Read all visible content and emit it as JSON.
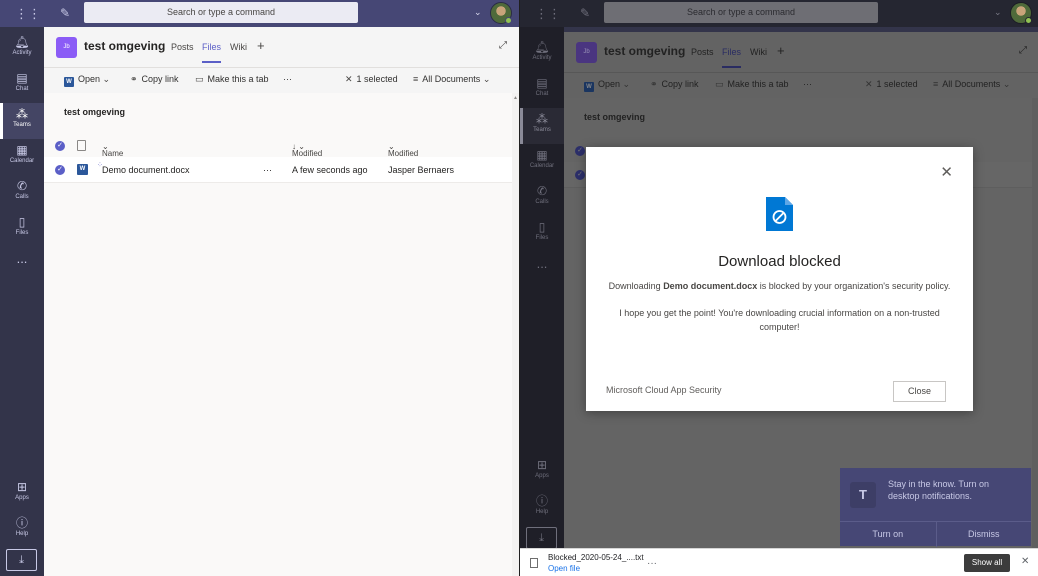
{
  "search": {
    "placeholder": "Search or type a command"
  },
  "rail": {
    "activity": "Activity",
    "chat": "Chat",
    "teams": "Teams",
    "calendar": "Calendar",
    "calls": "Calls",
    "files": "Files",
    "more": "...",
    "apps": "Apps",
    "help": "Help"
  },
  "channel": {
    "badge": "Jb",
    "team_name": "test omgeving",
    "tabs": [
      "Posts",
      "Files",
      "Wiki"
    ],
    "active_tab": "Files"
  },
  "commands": {
    "open": "Open",
    "copy_link": "Copy link",
    "make_tab": "Make this a tab",
    "more": "···",
    "selected": "1 selected",
    "view": "All Documents"
  },
  "library": {
    "title": "test omgeving",
    "columns": {
      "name": "Name",
      "modified": "Modified",
      "modified_by": "Modified By"
    },
    "rows": [
      {
        "name": "Demo document.docx",
        "modified": "A few seconds ago",
        "modified_by": "Jasper Bernaers"
      }
    ]
  },
  "modal": {
    "title": "Download blocked",
    "msg_prefix": "Downloading ",
    "msg_file": "Demo document.docx",
    "msg_suffix": " is blocked by your organization's security policy.",
    "custom_line1": "I hope you get the point! You're downloading crucial information on a non-trusted",
    "custom_line2": "computer!",
    "footer": "Microsoft Cloud App Security",
    "close_label": "Close"
  },
  "toast": {
    "text": "Stay in the know. Turn on desktop notifications.",
    "turn_on": "Turn on",
    "dismiss": "Dismiss"
  },
  "download_bar": {
    "file_name": "Blocked_2020-05-24_....txt",
    "open_file": "Open file",
    "show_all": "Show all"
  },
  "colors": {
    "teams_purple": "#464775",
    "accent": "#5b5fc7",
    "rail": "#33344a",
    "word_blue": "#2b579a",
    "blocked_icon": "#0078d4"
  }
}
